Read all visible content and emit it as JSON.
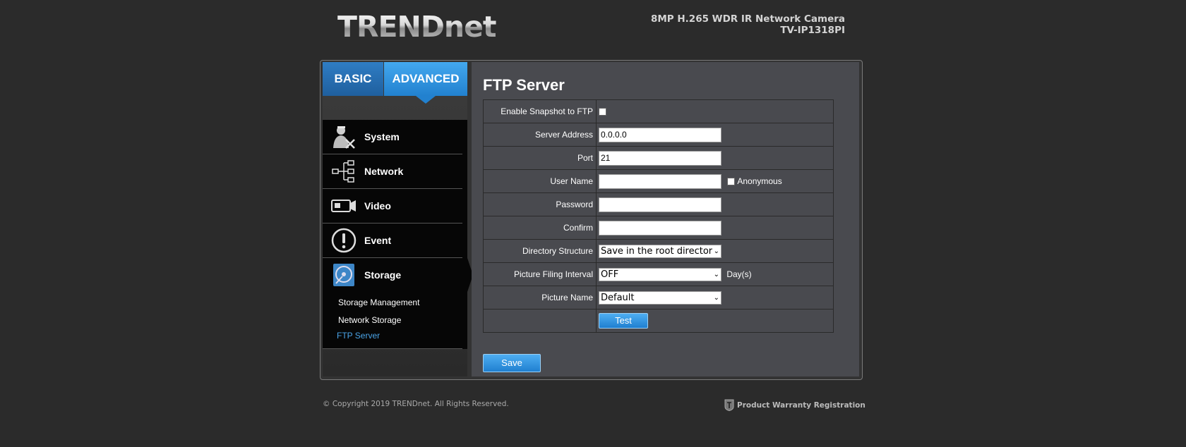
{
  "header": {
    "logo": "TRENDnet",
    "model_line1": "8MP H.265 WDR IR Network Camera",
    "model_line2": "TV-IP1318PI"
  },
  "tabs": [
    {
      "label": "BASIC"
    },
    {
      "label": "ADVANCED",
      "active": true
    }
  ],
  "menu": {
    "items": [
      {
        "label": "System",
        "icon": "user-settings-icon"
      },
      {
        "label": "Network",
        "icon": "network-tree-icon"
      },
      {
        "label": "Video",
        "icon": "camera-icon"
      },
      {
        "label": "Event",
        "icon": "alert-icon"
      },
      {
        "label": "Storage",
        "icon": "storage-disk-icon"
      }
    ],
    "subitems": [
      {
        "label": "Storage Management"
      },
      {
        "label": "Network Storage"
      },
      {
        "label": "FTP Server",
        "active": true
      }
    ]
  },
  "page": {
    "title": "FTP Server"
  },
  "form": {
    "enable_snapshot_label": "Enable Snapshot to FTP",
    "enable_snapshot_checked": false,
    "server_address_label": "Server Address",
    "server_address_value": "0.0.0.0",
    "port_label": "Port",
    "port_value": "21",
    "user_name_label": "User Name",
    "user_name_value": "",
    "anonymous_label": "Anonymous",
    "anonymous_checked": false,
    "password_label": "Password",
    "password_value": "",
    "confirm_label": "Confirm",
    "confirm_value": "",
    "directory_structure_label": "Directory Structure",
    "directory_structure_value": "Save in the root directory",
    "picture_filing_interval_label": "Picture Filing Interval",
    "picture_filing_interval_value": "OFF",
    "picture_filing_interval_unit": "Day(s)",
    "picture_name_label": "Picture Name",
    "picture_name_value": "Default",
    "test_label": "Test"
  },
  "actions": {
    "save_label": "Save"
  },
  "footer": {
    "copyright": "© Copyright 2019 TRENDnet. All Rights Reserved.",
    "warranty": "Product Warranty Registration"
  },
  "colors": {
    "accent": "#2281cf",
    "active_subitem": "#4aa3e6",
    "panel": "#494a4f",
    "background": "#2b2b2b"
  }
}
